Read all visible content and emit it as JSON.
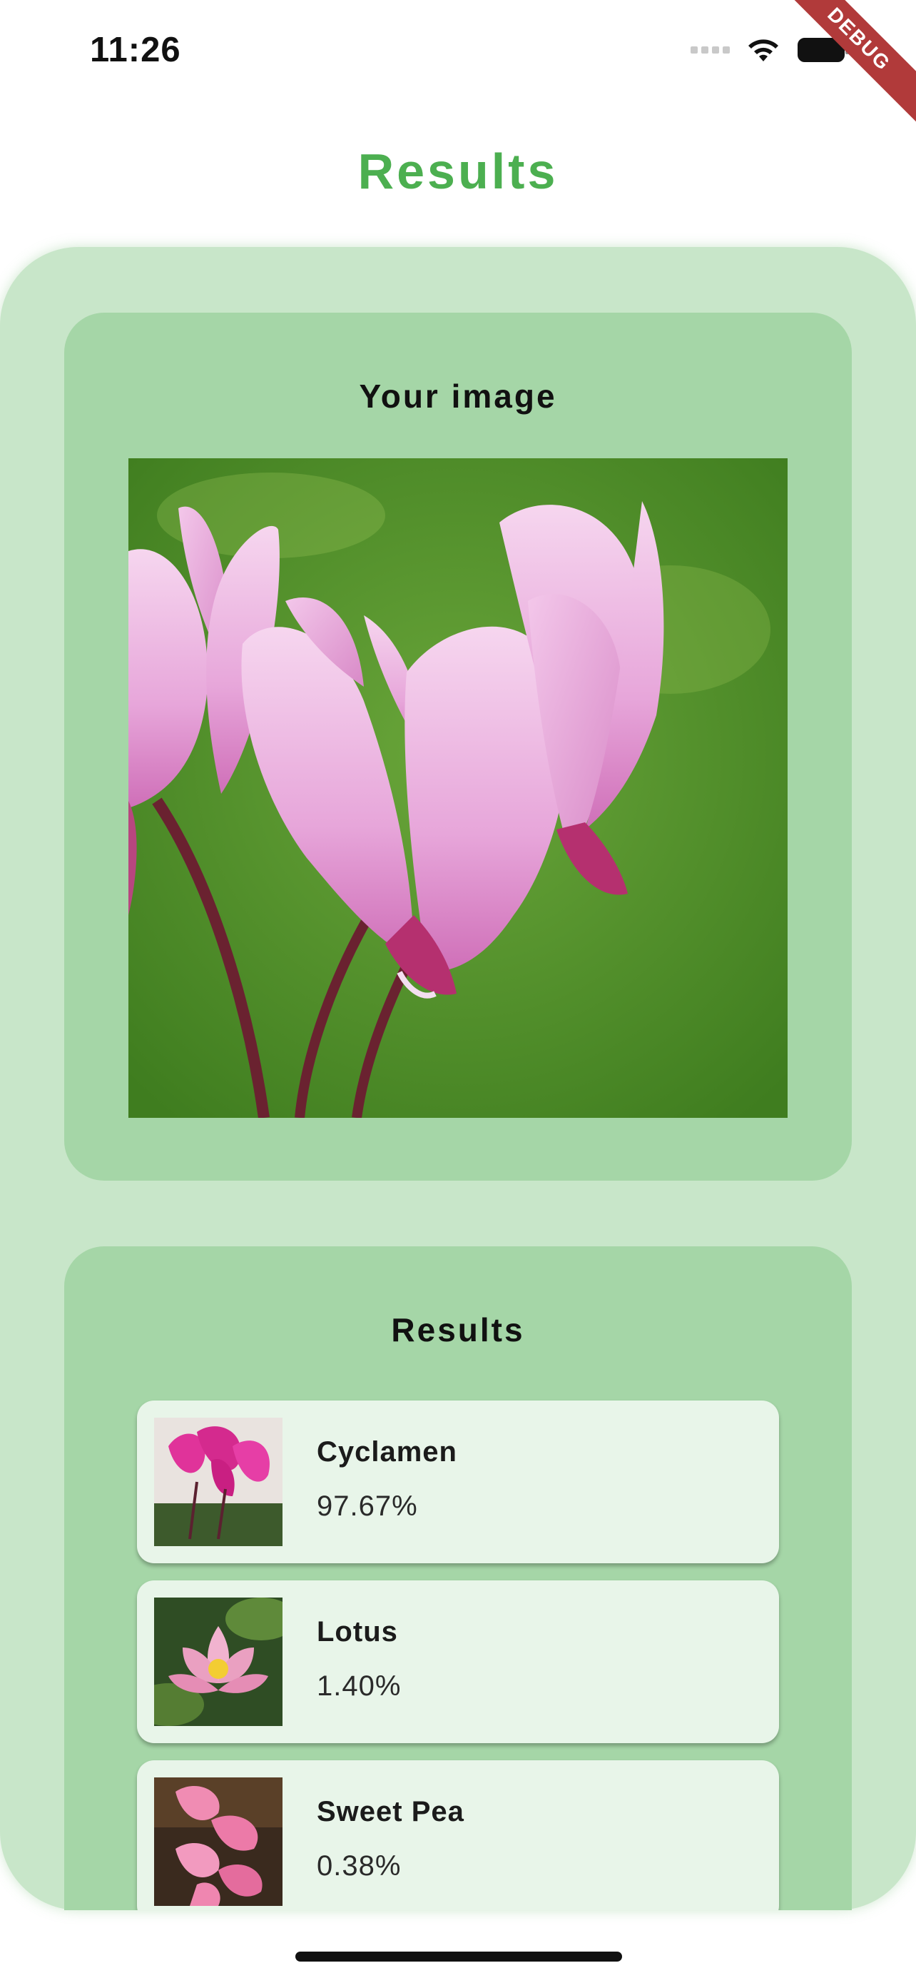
{
  "status_bar": {
    "time": "11:26",
    "icons": [
      "signal-icon",
      "wifi-icon",
      "battery-icon"
    ]
  },
  "debug_banner": "DEBUG",
  "page": {
    "title": "Results",
    "accent_color": "#4caf50",
    "panel_color": "#c8e6c9",
    "card_color": "#a5d6a7",
    "item_color": "#e8f5e9"
  },
  "image_card": {
    "heading": "Your image",
    "image": "cyclamen-photo"
  },
  "results_card": {
    "heading": "Results",
    "items": [
      {
        "name": "Cyclamen",
        "score": "97.67%",
        "thumb": "cyclamen-thumb"
      },
      {
        "name": "Lotus",
        "score": "1.40%",
        "thumb": "lotus-thumb"
      },
      {
        "name": "Sweet Pea",
        "score": "0.38%",
        "thumb": "sweet-pea-thumb"
      }
    ]
  }
}
